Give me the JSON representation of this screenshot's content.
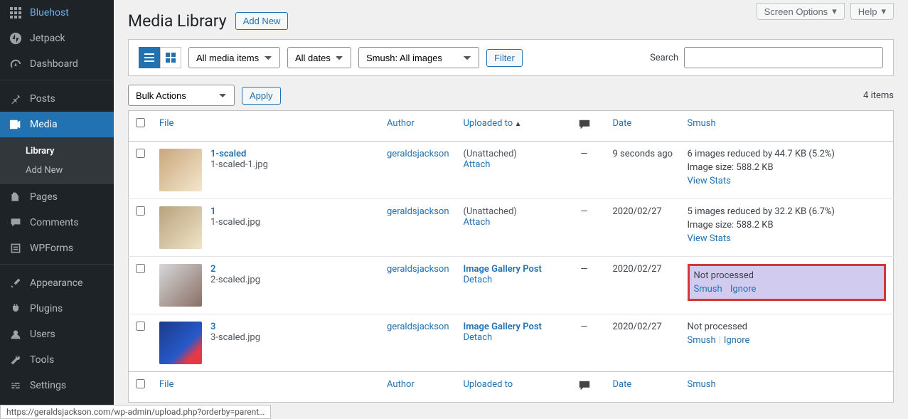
{
  "top_buttons": {
    "screen_options": "Screen Options",
    "help": "Help"
  },
  "sidebar": {
    "items": [
      {
        "label": "Bluehost",
        "icon": "grid"
      },
      {
        "label": "Jetpack",
        "icon": "jetpack"
      },
      {
        "label": "Dashboard",
        "icon": "gauge"
      },
      {
        "label": "Posts",
        "icon": "pin"
      },
      {
        "label": "Media",
        "icon": "media",
        "current": true
      },
      {
        "label": "Pages",
        "icon": "page"
      },
      {
        "label": "Comments",
        "icon": "chat"
      },
      {
        "label": "WPForms",
        "icon": "form"
      },
      {
        "label": "Appearance",
        "icon": "brush"
      },
      {
        "label": "Plugins",
        "icon": "plugin"
      },
      {
        "label": "Users",
        "icon": "user"
      },
      {
        "label": "Tools",
        "icon": "wrench"
      },
      {
        "label": "Settings",
        "icon": "sliders"
      }
    ],
    "submenu": {
      "library": "Library",
      "add_new": "Add New"
    }
  },
  "page": {
    "title": "Media Library",
    "add_new": "Add New"
  },
  "filters": {
    "media_items": "All media items",
    "dates": "All dates",
    "smush": "Smush: All images",
    "filter": "Filter",
    "search_label": "Search"
  },
  "bulk": {
    "actions": "Bulk Actions",
    "apply": "Apply",
    "count": "4 items"
  },
  "columns": {
    "file": "File",
    "author": "Author",
    "uploaded": "Uploaded to",
    "date": "Date",
    "smush": "Smush"
  },
  "rows": [
    {
      "title": "1-scaled",
      "filename": "1-scaled-1.jpg",
      "author": "geraldsjackson",
      "uploaded": "(Unattached)",
      "uploaded_action": "Attach",
      "comments": "—",
      "date": "9 seconds ago",
      "smush_line1": "6 images reduced by 44.7 KB (5.2%)",
      "smush_line2": "Image size: 588.2 KB",
      "smush_link": "View Stats",
      "highlight": false,
      "processed": true
    },
    {
      "title": "1",
      "filename": "1-scaled.jpg",
      "author": "geraldsjackson",
      "uploaded": "(Unattached)",
      "uploaded_action": "Attach",
      "comments": "—",
      "date": "2020/02/27",
      "smush_line1": "5 images reduced by 32.2 KB (6.7%)",
      "smush_line2": "Image size: 588.2 KB",
      "smush_link": "View Stats",
      "highlight": false,
      "processed": true
    },
    {
      "title": "2",
      "filename": "2-scaled.jpg",
      "author": "geraldsjackson",
      "uploaded": "Image Gallery Post",
      "uploaded_action": "Detach",
      "comments": "—",
      "date": "2020/02/27",
      "smush_status": "Not processed",
      "smush_action1": "Smush",
      "smush_action2": "Ignore",
      "highlight": true,
      "processed": false
    },
    {
      "title": "3",
      "filename": "3-scaled.jpg",
      "author": "geraldsjackson",
      "uploaded": "Image Gallery Post",
      "uploaded_action": "Detach",
      "comments": "—",
      "date": "2020/02/27",
      "smush_status": "Not processed",
      "smush_action1": "Smush",
      "smush_action2": "Ignore",
      "highlight": false,
      "processed": false
    }
  ],
  "status_url": "https://geraldsjackson.com/wp-admin/upload.php?orderby=parent…"
}
